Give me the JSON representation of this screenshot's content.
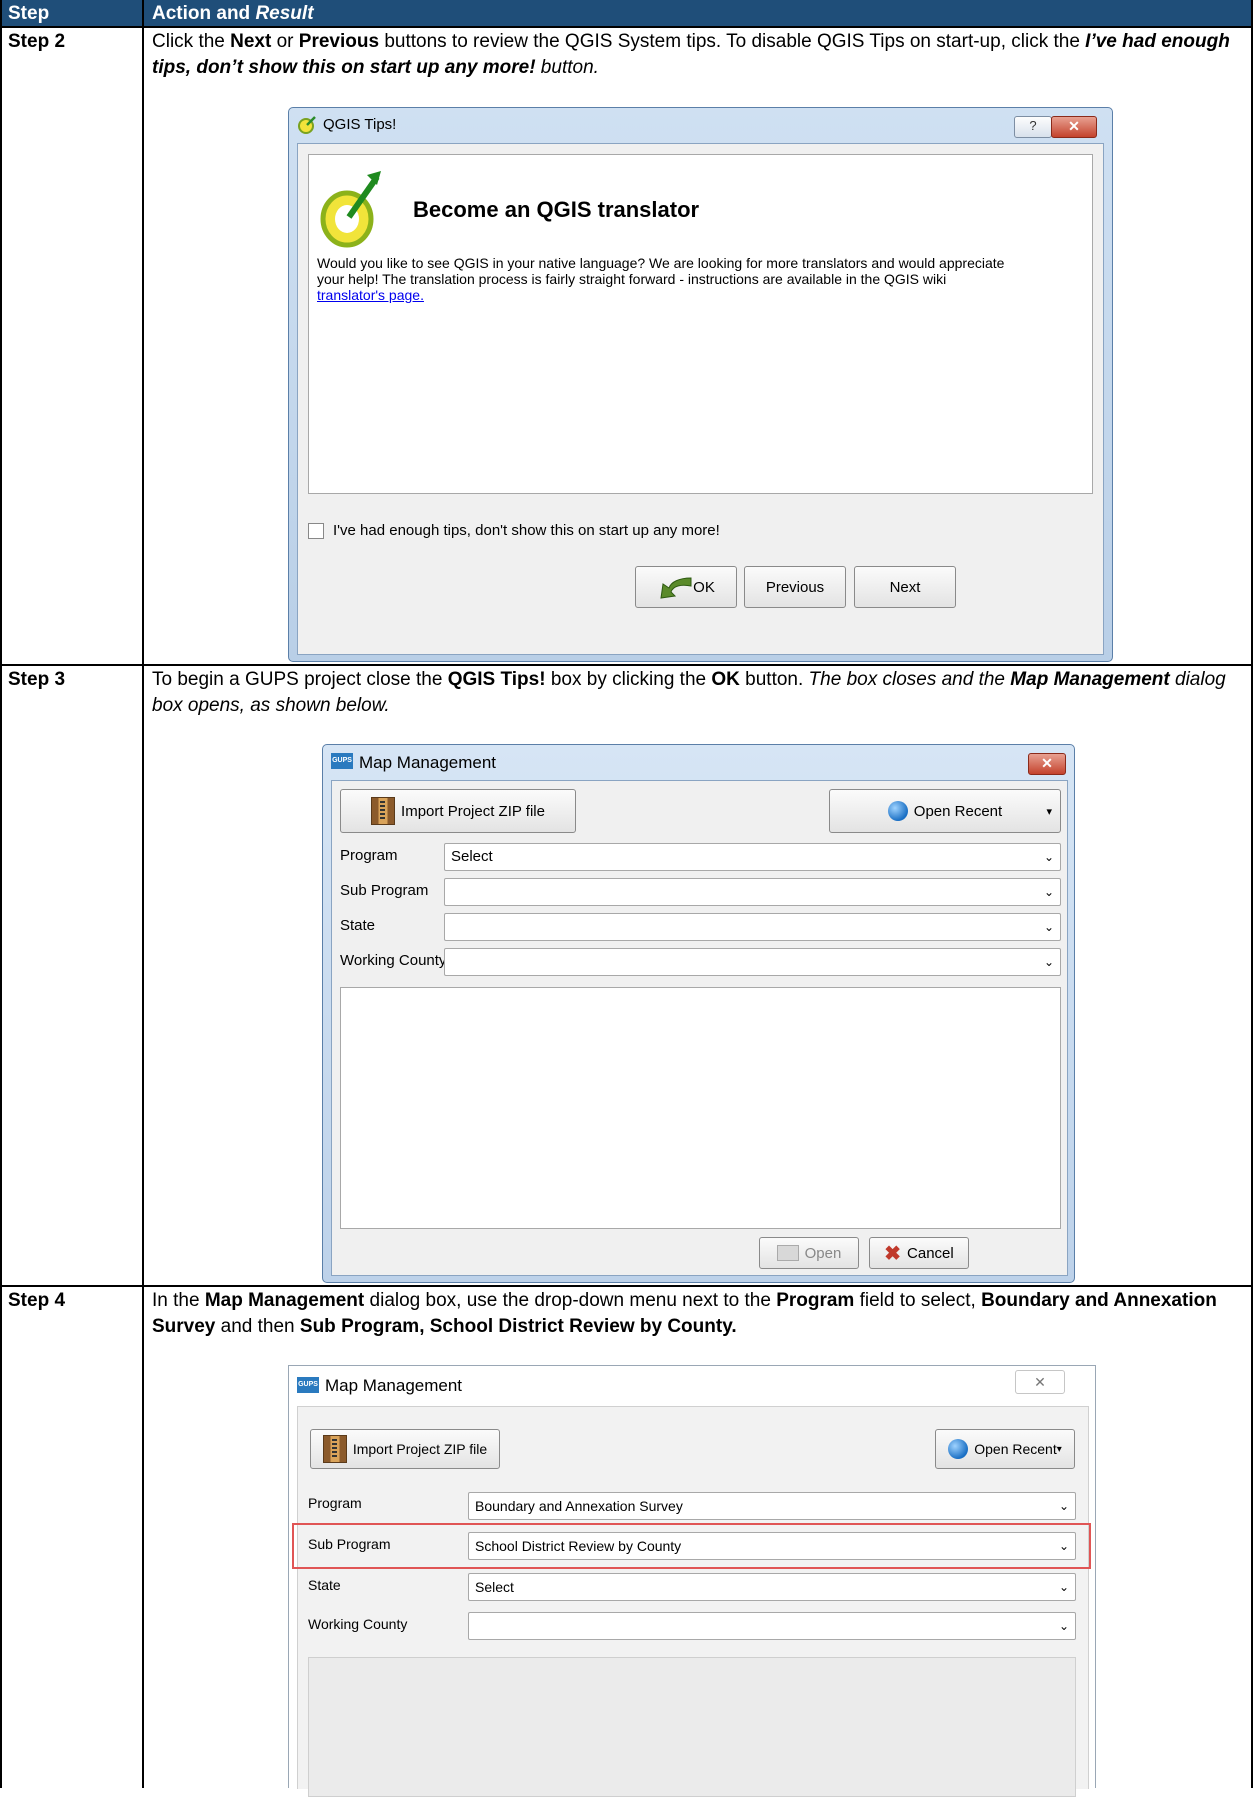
{
  "table": {
    "col_step": "Step",
    "col_action": "Action and",
    "col_action_italic": "Result"
  },
  "steps": [
    {
      "label": "Step 2"
    },
    {
      "label": "Step 3"
    },
    {
      "label": "Step 4"
    }
  ],
  "step2": {
    "t1": "Click the ",
    "b1": "Next",
    "t2": " or ",
    "b2": "Previous",
    "t3": " buttons to review the QGIS System tips. To disable QGIS Tips on start-up, click the ",
    "bi1": "I’ve had enough tips, don’t show this on start up any more!",
    "i1": " button."
  },
  "tips_dialog": {
    "title": "QGIS Tips!",
    "help": "?",
    "close": "✕",
    "heading": "Become an QGIS translator",
    "body": "Would you like to see QGIS in your native language? We are looking for more translators and would appreciate your help! The translation process is fairly straight forward - instructions are available in the QGIS wiki ",
    "link": "translator's page.",
    "checkbox_label": "I've had enough tips, don't show this on start up any more!",
    "ok": "OK",
    "previous": "Previous",
    "next": "Next"
  },
  "step3": {
    "t1": "To begin a GUPS project close the ",
    "b1": "QGIS Tips!",
    "t2": " box by clicking the ",
    "b2": "OK",
    "t3": " button. ",
    "i1": "The box closes and the ",
    "bi1": "Map Management",
    "i2": " dialog box opens, as shown below."
  },
  "mm1": {
    "icon": "GUPS",
    "title": "Map Management",
    "close": "✕",
    "import": "Import Project ZIP file",
    "recent": "Open Recent",
    "recent_arrow": "▾",
    "labels": [
      "Program",
      "Sub Program",
      "State",
      "Working County"
    ],
    "values": [
      "Select",
      "",
      "",
      ""
    ],
    "arrow": "⌄",
    "open": "Open",
    "cancel": "Cancel"
  },
  "step4": {
    "t1": "In the ",
    "b1": "Map Management",
    "t2": " dialog box, use the drop-down menu next to the ",
    "b2": "Program",
    "t3": " field to select, ",
    "b3": "Boundary and Annexation Survey",
    "t4": " and then ",
    "b4": "Sub Program, School District Review by County."
  },
  "mm2": {
    "icon": "GUPS",
    "title": "Map Management",
    "close": "✕",
    "import": "Import Project ZIP file",
    "recent": "Open Recent",
    "recent_arrow": "▾",
    "labels": [
      "Program",
      "Sub Program",
      "State",
      "Working County"
    ],
    "values": [
      "Boundary and Annexation Survey",
      "School District Review by County",
      "Select",
      ""
    ],
    "arrow": "⌄"
  },
  "colors": {
    "header": "#1f4e79",
    "highlight": "#e05555",
    "link": "#0000ee"
  }
}
